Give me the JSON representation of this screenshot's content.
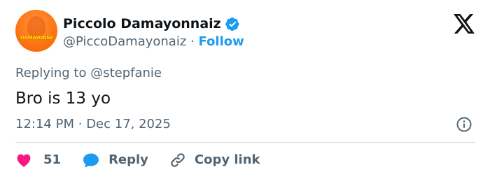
{
  "author": {
    "display_name": "Piccolo Damayonnaiz",
    "handle": "@PiccoDamayonaiz",
    "separator": "·",
    "follow_label": "Follow",
    "avatar_text": "DAMAYONNAIZ",
    "verified": true
  },
  "reply_context": {
    "prefix": "Replying to",
    "handle": "@stepfanie"
  },
  "tweet": {
    "text": "Bro is 13 yo",
    "time": "12:14 PM",
    "separator": "·",
    "date": "Dec 17, 2025"
  },
  "actions": {
    "like_count": "51",
    "reply_label": "Reply",
    "copy_label": "Copy link"
  },
  "icons": {
    "brand": "x-logo-icon",
    "verified": "verified-badge-icon",
    "info": "info-icon",
    "like": "heart-icon",
    "reply": "speech-bubble-icon",
    "copy": "link-icon"
  },
  "colors": {
    "accent": "#1d9bf0",
    "like": "#f91880",
    "text_primary": "#0f1419",
    "text_secondary": "#536471",
    "divider": "#cfd9de",
    "avatar": "#ff7a1a"
  }
}
